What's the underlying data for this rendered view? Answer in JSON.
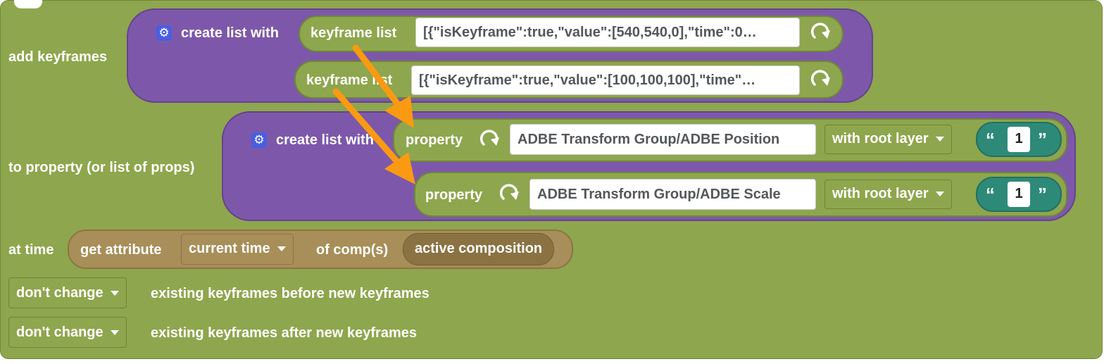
{
  "labels": {
    "add_keyframes": "add keyframes",
    "to_property": "to property (or list of props)",
    "at_time": "at time",
    "before_suffix": "existing keyframes before new keyframes",
    "after_suffix": "existing keyframes after new keyframes"
  },
  "create_list_1": {
    "label": "create list with",
    "items": [
      {
        "label": "keyframe list",
        "value": "[{\"isKeyframe\":true,\"value\":[540,540,0],\"time\":0…"
      },
      {
        "label": "keyframe list",
        "value": "[{\"isKeyframe\":true,\"value\":[100,100,100],\"time\"…"
      }
    ]
  },
  "create_list_2": {
    "label": "create list with",
    "items": [
      {
        "label": "property",
        "value": "ADBE Transform Group/ADBE Position",
        "root": "with root layer",
        "number": "1"
      },
      {
        "label": "property",
        "value": "ADBE Transform Group/ADBE Scale",
        "root": "with root layer",
        "number": "1"
      }
    ]
  },
  "time_block": {
    "get_attribute": "get attribute",
    "attribute": "current time",
    "of_comp": "of comp(s)",
    "comp": "active composition"
  },
  "before_dropdown": "don't change",
  "after_dropdown": "don't change",
  "quote_open": "“",
  "quote_close": "”",
  "icons": {
    "gear": "gear-icon",
    "refresh": "refresh-icon",
    "caret": "caret-down-icon",
    "arrow": "orange-arrow-annotation"
  },
  "colors": {
    "block_green": "#8ea64d",
    "list_purple": "#7d58aa",
    "text_teal": "#2e8a78",
    "attribute_tan": "#a88e58",
    "annotation_orange": "#fa9a12"
  }
}
